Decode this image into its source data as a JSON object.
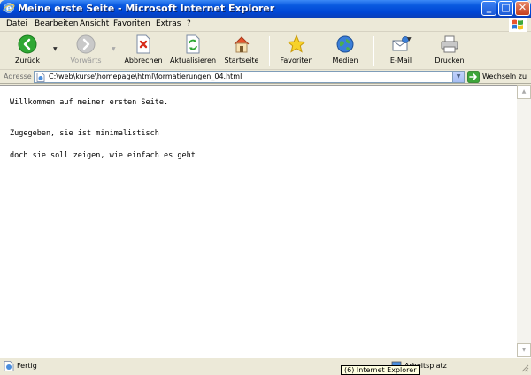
{
  "window": {
    "title": "Meine erste Seite - Microsoft Internet Explorer",
    "controls": {
      "minimize": "_",
      "maximize": "□",
      "close": "✕"
    }
  },
  "menubar": {
    "items": [
      {
        "label": "Datei"
      },
      {
        "label": "Bearbeiten"
      },
      {
        "label": "Ansicht"
      },
      {
        "label": "Favoriten"
      },
      {
        "label": "Extras"
      },
      {
        "label": "?"
      }
    ]
  },
  "toolbar": {
    "back": {
      "label": "Zurück",
      "icon": "back-arrow-icon"
    },
    "forward": {
      "label": "Vorwärts",
      "icon": "forward-arrow-icon",
      "enabled": false
    },
    "stop": {
      "label": "Abbrechen",
      "icon": "stop-icon"
    },
    "refresh": {
      "label": "Aktualisieren",
      "icon": "refresh-icon"
    },
    "home": {
      "label": "Startseite",
      "icon": "home-icon"
    },
    "favorites": {
      "label": "Favoriten",
      "icon": "star-icon"
    },
    "media": {
      "label": "Medien",
      "icon": "media-globe-icon"
    },
    "mail": {
      "label": "E-Mail",
      "icon": "mail-icon"
    },
    "print": {
      "label": "Drucken",
      "icon": "printer-icon"
    }
  },
  "addressbar": {
    "label": "Adresse",
    "value": "C:\\web\\kurse\\homepage\\html\\formatierungen_04.html",
    "go_label": "Wechseln zu"
  },
  "page": {
    "lines": [
      "Willkommen auf meiner ersten Seite.",
      "Zugegeben, sie ist minimalistisch",
      "doch sie soll zeigen, wie einfach es geht"
    ]
  },
  "statusbar": {
    "status": "Fertig",
    "zone": "Arbeitsplatz"
  },
  "tooltip": {
    "text": "(6) Internet Explorer"
  },
  "colors": {
    "titlebar": "#0a5ae0",
    "chrome": "#ece9d8",
    "content_bg": "#ffffff",
    "back_green": "#2fa834",
    "tooltip_bg": "#ffffe1"
  }
}
